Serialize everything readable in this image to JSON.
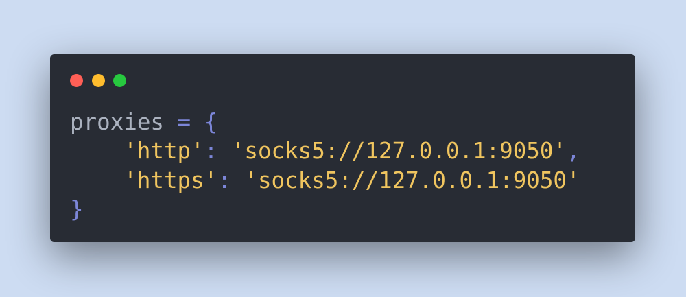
{
  "window": {
    "controls": [
      {
        "name": "close",
        "color": "#ff5f56"
      },
      {
        "name": "minimize",
        "color": "#ffbd2e"
      },
      {
        "name": "maximize",
        "color": "#27c93f"
      }
    ]
  },
  "code": {
    "variable": "proxies",
    "assign": " = ",
    "open_brace": "{",
    "close_brace": "}",
    "entries": [
      {
        "key": "'http'",
        "value": "'socks5://127.0.0.1:9050'",
        "comma": ","
      },
      {
        "key": "'https'",
        "value": "'socks5://127.0.0.1:9050'",
        "comma": ""
      }
    ]
  }
}
